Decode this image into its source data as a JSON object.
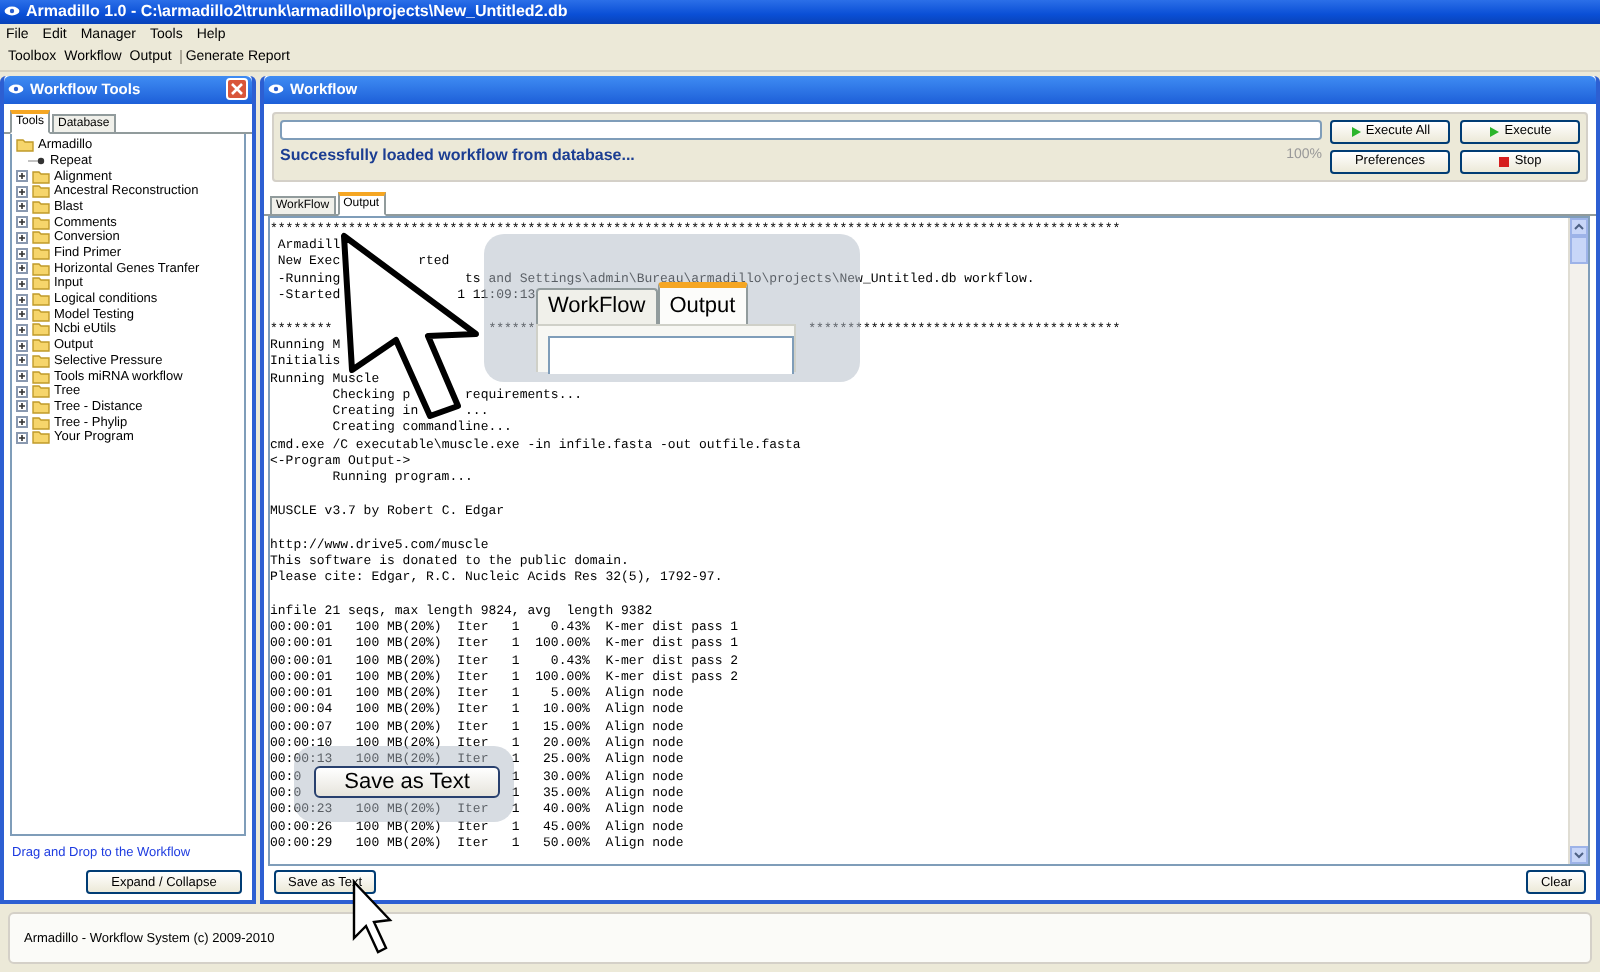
{
  "window": {
    "title": "Armadillo 1.0 - C:\\armadillo2\\trunk\\armadillo\\projects\\New_Untitled2.db"
  },
  "menu": [
    "File",
    "Edit",
    "Manager",
    "Tools",
    "Help"
  ],
  "toolbar": [
    [
      "Toolbox",
      "Workflow",
      "Output"
    ],
    [
      "Generate Report"
    ]
  ],
  "tools_panel": {
    "title": "Workflow Tools",
    "tabs": [
      {
        "label": "Tools",
        "selected": true
      },
      {
        "label": "Database",
        "selected": false
      }
    ],
    "tree": [
      {
        "label": "Armadillo",
        "kind": "root",
        "children": [
          {
            "label": "Repeat",
            "kind": "leaf"
          }
        ]
      },
      {
        "label": "Alignment",
        "kind": "folder"
      },
      {
        "label": "Ancestral Reconstruction",
        "kind": "folder"
      },
      {
        "label": "Blast",
        "kind": "folder"
      },
      {
        "label": "Comments",
        "kind": "folder"
      },
      {
        "label": "Conversion",
        "kind": "folder"
      },
      {
        "label": "Find Primer",
        "kind": "folder"
      },
      {
        "label": "Horizontal Genes Tranfer",
        "kind": "folder"
      },
      {
        "label": "Input",
        "kind": "folder"
      },
      {
        "label": "Logical conditions",
        "kind": "folder"
      },
      {
        "label": "Model Testing",
        "kind": "folder"
      },
      {
        "label": "Ncbi eUtils",
        "kind": "folder"
      },
      {
        "label": "Output",
        "kind": "folder"
      },
      {
        "label": "Selective Pressure",
        "kind": "folder"
      },
      {
        "label": "Tools miRNA workflow",
        "kind": "folder"
      },
      {
        "label": "Tree",
        "kind": "folder"
      },
      {
        "label": "Tree - Distance",
        "kind": "folder"
      },
      {
        "label": "Tree - Phylip",
        "kind": "folder"
      },
      {
        "label": "Your Program",
        "kind": "folder"
      }
    ],
    "hint": "Drag and Drop to the Workflow",
    "button": "Expand / Collapse"
  },
  "workflow_panel": {
    "title": "Workflow",
    "status": "Successfully loaded workflow from database...",
    "percent": "100%",
    "level": 0,
    "buttons": [
      {
        "label": "Execute All",
        "kind": "play"
      },
      {
        "label": "Execute",
        "kind": "play"
      },
      {
        "label": "Preferences",
        "kind": "plain"
      },
      {
        "label": "Stop",
        "kind": "stop"
      }
    ],
    "tabs": [
      {
        "label": "WorkFlow",
        "selected": false
      },
      {
        "label": "Output",
        "selected": true
      }
    ],
    "output": [
      [
        "*************************************************************************************************************"
      ],
      [
        "Armadill"
      ],
      [
        "New Exec",
        "rted"
      ],
      [
        "-Running",
        "ts and Settings\\admin\\Bureau\\armadillo\\projects\\New_Untitled.db workflow."
      ],
      [
        "-Started",
        "1 11:09:13"
      ],
      {
        "kind": "blank"
      },
      [
        "********",
        "******",
        "****************************************"
      ],
      [
        "Running M"
      ],
      [
        "Initialis"
      ],
      [
        "Running Muscle"
      ],
      [
        "Checking p",
        "requirements..."
      ],
      [
        "Creating in",
        "..."
      ],
      [
        "Creating commandline..."
      ],
      [
        "cmd.exe /C executable\\muscle.exe -in infile.fasta -out outfile.fasta"
      ],
      [
        "<-Program Output->"
      ],
      [
        "Running program..."
      ],
      {
        "kind": "blank"
      },
      [
        "MUSCLE v3.7 by Robert C. Edgar"
      ],
      {
        "kind": "blank"
      },
      [
        "http://www.drive5.com/muscle"
      ],
      [
        "This software is donated to the public domain."
      ],
      [
        "Please cite: Edgar, R.C. Nucleic Acids Res 32(5), 1792-97."
      ],
      {
        "kind": "blank"
      },
      [
        "infile 21 seqs, max length 9824, avg  length 9382"
      ],
      [
        "00:00:01   100 MB(20%)  Iter   1    0.43%  K-mer dist pass 1"
      ],
      [
        "00:00:01   100 MB(20%)  Iter   1  100.00%  K-mer dist pass 1"
      ],
      [
        "00:00:01   100 MB(20%)  Iter   1    0.43%  K-mer dist pass 2"
      ],
      [
        "00:00:01   100 MB(20%)  Iter   1  100.00%  K-mer dist pass 2"
      ],
      [
        "00:00:01   100 MB(20%)  Iter   1    5.00%  Align node"
      ],
      [
        "00:00:04   100 MB(20%)  Iter   1   10.00%  Align node"
      ],
      [
        "00:00:07   100 MB(20%)  Iter   1   15.00%  Align node"
      ],
      [
        "00:00:10   100 MB(20%)  Iter   1   20.00%  Align node"
      ],
      [
        "00:00:13   100 MB(20%)  Iter   1   25.00%  Align node"
      ],
      [
        "00:0",
        "1   30.00%  Align node"
      ],
      [
        "00:0",
        "1   35.00%  Align node"
      ],
      [
        "00:00:23   100 MB(20%)  Iter   1   40.00%  Align node"
      ],
      [
        "00:00:26   100 MB(20%)  Iter   1   45.00%  Align node"
      ],
      [
        "00:00:29   100 MB(20%)  Iter   1   50.00%  Align node"
      ]
    ],
    "bottom_buttons": [
      "Save as Text",
      "Clear"
    ]
  },
  "callouts": {
    "tabs": [
      {
        "label": "WorkFlow",
        "selected": false
      },
      {
        "label": "Output",
        "selected": true
      }
    ],
    "button": "Save as Text"
  },
  "status_bar": "Armadillo - Workflow System (c) 2009-2010"
}
